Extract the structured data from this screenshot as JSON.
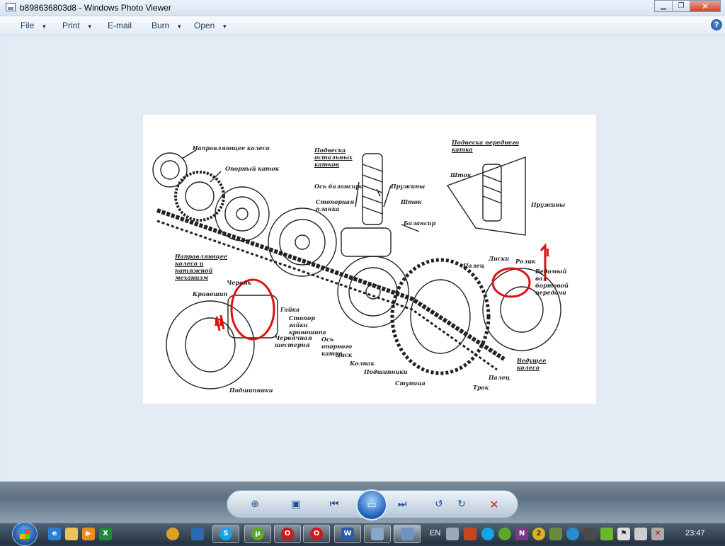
{
  "window": {
    "title": "b898636803d8 - Windows Photo Viewer"
  },
  "menu": {
    "items": [
      "File",
      "Print",
      "E-mail",
      "Burn",
      "Open"
    ],
    "help_label": "?"
  },
  "photo": {
    "labels": {
      "napr_koleso": "Направляющее колесо",
      "opor_katok": "Опорный каток",
      "podveska_ost": "Подвеска остальных катков",
      "os_balansira": "Ось балансира",
      "stop_planka": "Стопорная планка",
      "pruzhiny": "Пружины",
      "shtok": "Шток",
      "balansir": "Балансир",
      "podveska_pered": "Подвеска переднего катка",
      "shtok2": "Шток",
      "pruzhiny2": "Пружины",
      "diski": "Диски",
      "rolik": "Ролик",
      "palec": "Палец",
      "vedomy": "Ведомый вал бортовой передачи",
      "napr_mech": "Направляющее колесо и натяжной механизм",
      "chervyak": "Червяк",
      "krivoship": "Кривошип",
      "gayka": "Гайка",
      "stopor": "Стопор гайки кривошипа",
      "cherv_shest": "Червячная шестерня",
      "os_opor": "Ось опорного катка",
      "disk": "Диск",
      "kolpak": "Колпак",
      "podshipniki": "Подшипники",
      "podshipniki2": "Подшипники",
      "stupica": "Ступица",
      "trak": "Трак",
      "palec2": "Палец",
      "vedushee": "Ведущее колесо",
      "mark1": "1",
      "mark2": "II"
    }
  },
  "controls": {
    "zoom": "⊕",
    "fit": "▣",
    "prev": "⏮",
    "slideshow": "▭",
    "next": "⏭",
    "rotate_ccw": "↺",
    "rotate_cw": "↻",
    "delete": "✕"
  },
  "taskbar": {
    "language": "EN",
    "clock": "23:47",
    "icon_letters": {
      "excel": "X",
      "skype": "S",
      "utorrent": "µ",
      "opera": "O",
      "opera2": "O",
      "word": "W",
      "onenote": "N",
      "badge": "2"
    }
  }
}
